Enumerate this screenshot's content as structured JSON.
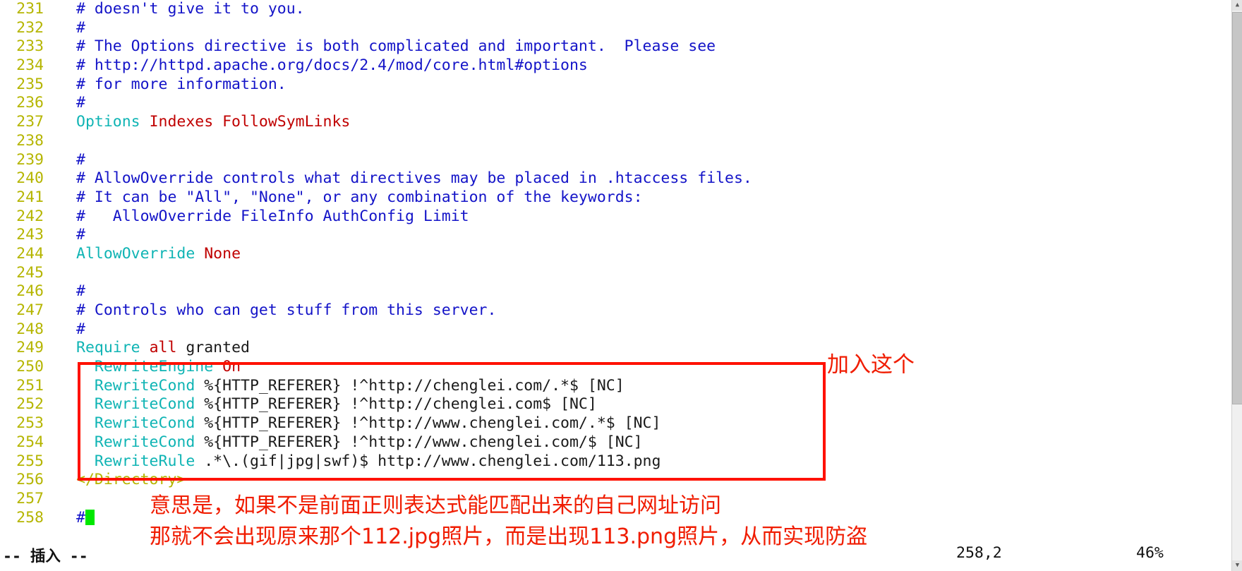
{
  "editor": {
    "app": "vim",
    "filetype": "apache-config",
    "first_line_number": 231,
    "lines": [
      {
        "n": "231",
        "segments": [
          {
            "t": "# doesn't give it to you.",
            "c": "cmt"
          }
        ]
      },
      {
        "n": "232",
        "segments": [
          {
            "t": "#",
            "c": "cmt"
          }
        ]
      },
      {
        "n": "233",
        "segments": [
          {
            "t": "# The Options directive is both complicated and important.  Please see",
            "c": "cmt"
          }
        ]
      },
      {
        "n": "234",
        "segments": [
          {
            "t": "# http://httpd.apache.org/docs/2.4/mod/core.html#options",
            "c": "cmt"
          }
        ]
      },
      {
        "n": "235",
        "segments": [
          {
            "t": "# for more information.",
            "c": "cmt"
          }
        ]
      },
      {
        "n": "236",
        "segments": [
          {
            "t": "#",
            "c": "cmt"
          }
        ]
      },
      {
        "n": "237",
        "segments": [
          {
            "t": "Options",
            "c": "dir"
          },
          {
            "t": " ",
            "c": "plain"
          },
          {
            "t": "Indexes FollowSymLinks",
            "c": "val"
          }
        ]
      },
      {
        "n": "238",
        "segments": [
          {
            "t": "",
            "c": "plain"
          }
        ]
      },
      {
        "n": "239",
        "segments": [
          {
            "t": "#",
            "c": "cmt"
          }
        ]
      },
      {
        "n": "240",
        "segments": [
          {
            "t": "# AllowOverride controls what directives may be placed in .htaccess files.",
            "c": "cmt"
          }
        ]
      },
      {
        "n": "241",
        "segments": [
          {
            "t": "# It can be \"All\", \"None\", or any combination of the keywords:",
            "c": "cmt"
          }
        ]
      },
      {
        "n": "242",
        "segments": [
          {
            "t": "#   AllowOverride FileInfo AuthConfig Limit",
            "c": "cmt"
          }
        ]
      },
      {
        "n": "243",
        "segments": [
          {
            "t": "#",
            "c": "cmt"
          }
        ]
      },
      {
        "n": "244",
        "segments": [
          {
            "t": "AllowOverride",
            "c": "dir"
          },
          {
            "t": " ",
            "c": "plain"
          },
          {
            "t": "None",
            "c": "val"
          }
        ]
      },
      {
        "n": "245",
        "segments": [
          {
            "t": "",
            "c": "plain"
          }
        ]
      },
      {
        "n": "246",
        "segments": [
          {
            "t": "#",
            "c": "cmt"
          }
        ]
      },
      {
        "n": "247",
        "segments": [
          {
            "t": "# Controls who can get stuff from this server.",
            "c": "cmt"
          }
        ]
      },
      {
        "n": "248",
        "segments": [
          {
            "t": "#",
            "c": "cmt"
          }
        ]
      },
      {
        "n": "249",
        "segments": [
          {
            "t": "Require",
            "c": "dir"
          },
          {
            "t": " ",
            "c": "plain"
          },
          {
            "t": "all",
            "c": "val"
          },
          {
            "t": " granted",
            "c": "plain"
          }
        ]
      },
      {
        "n": "250",
        "segments": [
          {
            "t": "  ",
            "c": "plain"
          },
          {
            "t": "RewriteEngine",
            "c": "dir"
          },
          {
            "t": " ",
            "c": "plain"
          },
          {
            "t": "On",
            "c": "val"
          }
        ]
      },
      {
        "n": "251",
        "segments": [
          {
            "t": "  ",
            "c": "plain"
          },
          {
            "t": "RewriteCond",
            "c": "dir"
          },
          {
            "t": " %{HTTP_REFERER} !^http://chenglei.com/.*$ [NC]",
            "c": "plain"
          }
        ]
      },
      {
        "n": "252",
        "segments": [
          {
            "t": "  ",
            "c": "plain"
          },
          {
            "t": "RewriteCond",
            "c": "dir"
          },
          {
            "t": " %{HTTP_REFERER} !^http://chenglei.com$ [NC]",
            "c": "plain"
          }
        ]
      },
      {
        "n": "253",
        "segments": [
          {
            "t": "  ",
            "c": "plain"
          },
          {
            "t": "RewriteCond",
            "c": "dir"
          },
          {
            "t": " %{HTTP_REFERER} !^http://www.chenglei.com/.*$ [NC]",
            "c": "plain"
          }
        ]
      },
      {
        "n": "254",
        "segments": [
          {
            "t": "  ",
            "c": "plain"
          },
          {
            "t": "RewriteCond",
            "c": "dir"
          },
          {
            "t": " %{HTTP_REFERER} !^http://www.chenglei.com/$ [NC]",
            "c": "plain"
          }
        ]
      },
      {
        "n": "255",
        "segments": [
          {
            "t": "  ",
            "c": "plain"
          },
          {
            "t": "RewriteRule",
            "c": "dir"
          },
          {
            "t": " .*\\.(gif|jpg|swf)$ http://www.chenglei.com/113.png",
            "c": "plain"
          }
        ]
      },
      {
        "n": "256",
        "segments": [
          {
            "t": "</Directory>",
            "c": "tag"
          }
        ]
      },
      {
        "n": "257",
        "segments": [
          {
            "t": "",
            "c": "plain"
          }
        ]
      },
      {
        "n": "258",
        "segments": [
          {
            "t": "#",
            "c": "cmt"
          }
        ],
        "cursor": true
      }
    ]
  },
  "annotations": {
    "add_this": "加入这个",
    "explain_line1": "意思是，如果不是前面正则表达式能匹配出来的自己网址访问",
    "explain_line2": "那就不会出现原来那个112.jpg照片，而是出现113.png照片，从而实现防盗"
  },
  "statusbar": {
    "mode": "-- 插入 --",
    "position": "258,2",
    "percent": "46%"
  },
  "scrollbar": {
    "up_arrow": "▲",
    "down_arrow": "▼"
  },
  "colors": {
    "line_number": "#b5b500",
    "comment": "#1414c8",
    "directive": "#0fb4b4",
    "value": "#c00000",
    "plain": "#1a1a1a",
    "annotation_red": "#f01c00",
    "box_red": "#ff1100",
    "cursor_green": "#00e800",
    "background": "#ffffff"
  }
}
